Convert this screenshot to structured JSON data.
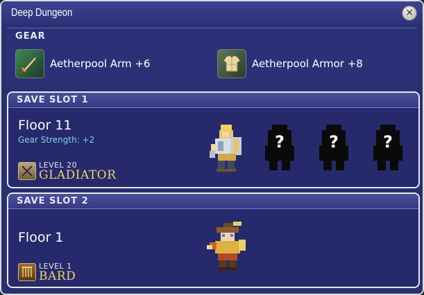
{
  "window": {
    "title": "Deep Dungeon",
    "close_icon": "close-cross-icon"
  },
  "gear": {
    "header": "GEAR",
    "items": [
      {
        "label": "Aetherpool Arm +6",
        "icon": "sword-icon"
      },
      {
        "label": "Aetherpool Armor +8",
        "icon": "armor-icon"
      }
    ]
  },
  "slots": [
    {
      "header": "SAVE SLOT 1",
      "floor": "Floor 11",
      "gear_strength": "Gear Strength: +2",
      "level": "LEVEL 20",
      "job": "GLADIATOR",
      "job_icon": "gladiator-job-icon",
      "party": [
        "gladiator-sprite",
        "unknown-member-sprite",
        "unknown-member-sprite",
        "unknown-member-sprite"
      ]
    },
    {
      "header": "SAVE SLOT 2",
      "floor": "Floor 1",
      "level": "LEVEL 1",
      "job": "BARD",
      "job_icon": "bard-job-icon",
      "party": [
        "bard-sprite"
      ]
    }
  ],
  "colors": {
    "panel": "#2a2f6e",
    "header": "#4c5098",
    "job_name": "#f0d36a",
    "gear_strength": "#7ed4e8"
  }
}
